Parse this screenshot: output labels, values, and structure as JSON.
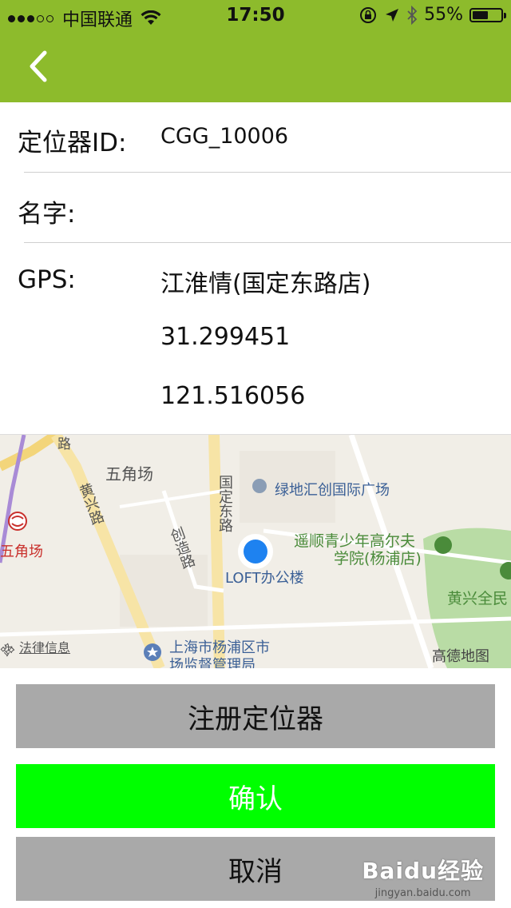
{
  "status_bar": {
    "carrier": "中国联通",
    "time": "17:50",
    "battery": "55%",
    "battery_level": 0.55,
    "signal_bars_filled": 3,
    "signal_bars_total": 5
  },
  "header": {
    "color": "#8dbb2c",
    "back_icon": "chevron-left-icon"
  },
  "form": {
    "device_id_label": "定位器ID:",
    "device_id_value": "CGG_10006",
    "name_label": "名字:",
    "name_value": "",
    "gps_label": "GPS:",
    "gps_place": "江淮情(国定东路店)",
    "gps_lat": "31.299451",
    "gps_lng": "121.516056"
  },
  "map": {
    "labels": {
      "wujiaochang_top": "五角场",
      "wujiaochang_left": "五角场",
      "huangxing_road": "黄兴路",
      "guoding_east_road": "国定东路",
      "chuangzao_road": "创造路",
      "lvdi": "绿地汇创国际广场",
      "yaoshun_1": "遥顺青少年高尔夫",
      "yaoshun_2": "学院(杨浦店)",
      "huangxing_park": "黄兴全民",
      "loft": "LOFT办公楼",
      "market_1": "上海市杨浦区市",
      "market_2": "场监督管理局",
      "legal": "法律信息",
      "provider": "高德地图",
      "road_top": "路",
      "road_corner": "路"
    }
  },
  "buttons": {
    "register": "注册定位器",
    "confirm": "确认",
    "cancel": "取消",
    "register_color": "#a9a9a9",
    "confirm_color": "#00ff00",
    "cancel_color": "#a9a9a9"
  },
  "watermark": {
    "main": "Baidu经验",
    "sub": "jingyan.baidu.com"
  }
}
